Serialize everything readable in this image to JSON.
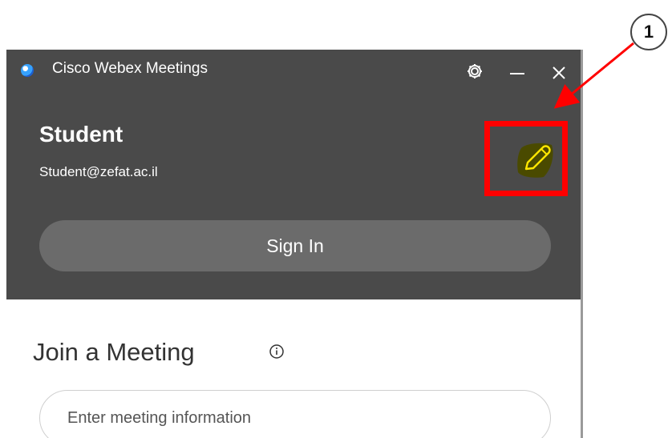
{
  "window": {
    "title": "Cisco Webex Meetings"
  },
  "user": {
    "name": "Student",
    "email": "Student@zefat.ac.il"
  },
  "actions": {
    "sign_in_label": "Sign In"
  },
  "join": {
    "title": "Join a Meeting",
    "input_placeholder": "Enter meeting information",
    "input_value": ""
  },
  "annotation": {
    "number": "1"
  },
  "icons": {
    "app_logo": "webex-logo-icon",
    "settings": "gear-icon",
    "minimize": "minimize-icon",
    "close": "close-icon",
    "edit": "pencil-icon",
    "info": "info-icon"
  },
  "colors": {
    "header_bg": "#4a4a4a",
    "sign_in_bg": "#6b6b6b",
    "highlight": "#ff0000",
    "pencil_highlight": "#4a4a00",
    "pencil": "#ffe600",
    "arrow": "#ff0000"
  }
}
